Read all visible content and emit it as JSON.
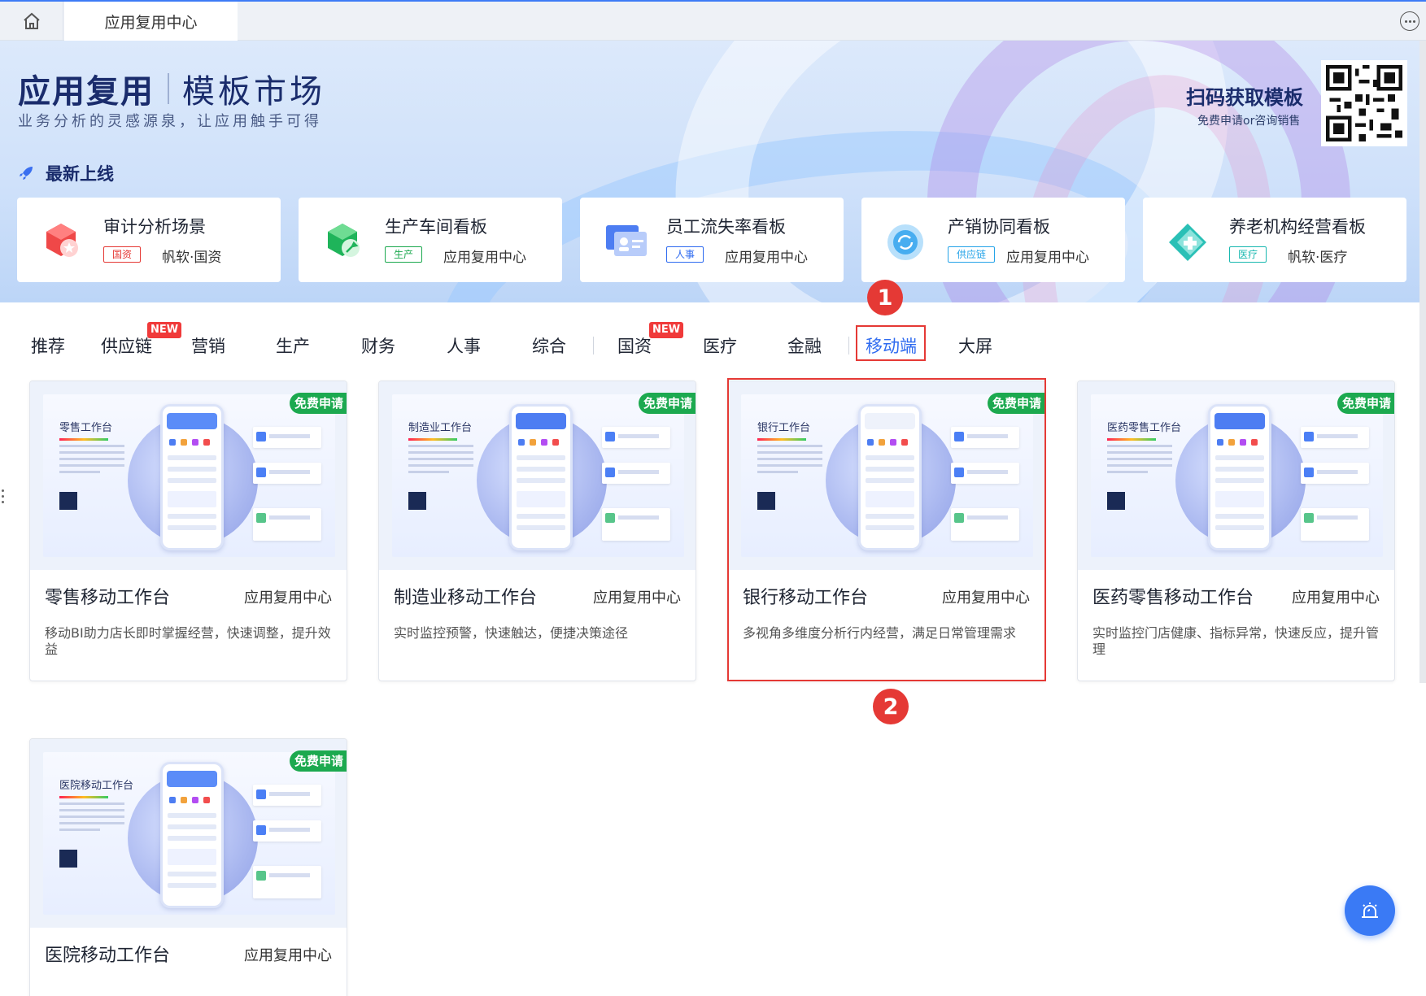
{
  "top_tab": {
    "title": "应用复用中心"
  },
  "banner": {
    "brand_a": "应用复用",
    "brand_b": "模板市场",
    "slogan": "业务分析的灵感源泉，让应用触手可得",
    "qr_title": "扫码获取模板",
    "qr_sub": "免费申请or咨询销售",
    "latest_label": "最新上线"
  },
  "new_cards": [
    {
      "title": "审计分析场景",
      "tag": "国资",
      "tag_color": "#e53935",
      "source": "帆软·国资",
      "icon": "red-cube-icon"
    },
    {
      "title": "生产车间看板",
      "tag": "生产",
      "tag_color": "#1ca94f",
      "source": "应用复用中心",
      "icon": "green-wrench-icon"
    },
    {
      "title": "员工流失率看板",
      "tag": "人事",
      "tag_color": "#2f6bf0",
      "source": "应用复用中心",
      "icon": "id-card-icon"
    },
    {
      "title": "产销协同看板",
      "tag": "供应链",
      "tag_color": "#26a4e8",
      "source": "应用复用中心",
      "icon": "sync-icon"
    },
    {
      "title": "养老机构经营看板",
      "tag": "医疗",
      "tag_color": "#19b8b0",
      "source": "帆软·医疗",
      "icon": "medical-cross-icon"
    }
  ],
  "markers": {
    "m1": "1",
    "m2": "2"
  },
  "categories": [
    {
      "label": "推荐"
    },
    {
      "label": "供应链",
      "badge": "NEW"
    },
    {
      "label": "营销"
    },
    {
      "label": "生产"
    },
    {
      "label": "财务"
    },
    {
      "label": "人事"
    },
    {
      "label": "综合"
    },
    {
      "label": "国资",
      "badge": "NEW"
    },
    {
      "label": "医疗"
    },
    {
      "label": "金融"
    },
    {
      "label": "移动端",
      "active": true
    },
    {
      "label": "大屏"
    }
  ],
  "templates": [
    {
      "name": "零售移动工作台",
      "source": "应用复用中心",
      "desc": "移动BI助力店长即时掌握经营，快速调整，提升效益",
      "badge": "免费申请",
      "mini_title": "零售工作台",
      "header_color": "#5b8cf8"
    },
    {
      "name": "制造业移动工作台",
      "source": "应用复用中心",
      "desc": "实时监控预警，快速触达，便捷决策途径",
      "badge": "免费申请",
      "mini_title": "制造业工作台",
      "header_color": "#4d7df2"
    },
    {
      "name": "银行移动工作台",
      "source": "应用复用中心",
      "desc": "多视角多维度分析行内经营，满足日常管理需求",
      "badge": "免费申请",
      "mini_title": "银行工作台",
      "header_color": "#ffffff"
    },
    {
      "name": "医药零售移动工作台",
      "source": "应用复用中心",
      "desc": "实时监控门店健康、指标异常，快速反应，提升管理",
      "badge": "免费申请",
      "mini_title": "医药零售工作台",
      "header_color": "#4d7df2"
    },
    {
      "name": "医院移动工作台",
      "source": "应用复用中心",
      "desc": "",
      "badge": "免费申请",
      "mini_title": "医院移动工作台",
      "header_color": "#5b8cf8"
    }
  ]
}
